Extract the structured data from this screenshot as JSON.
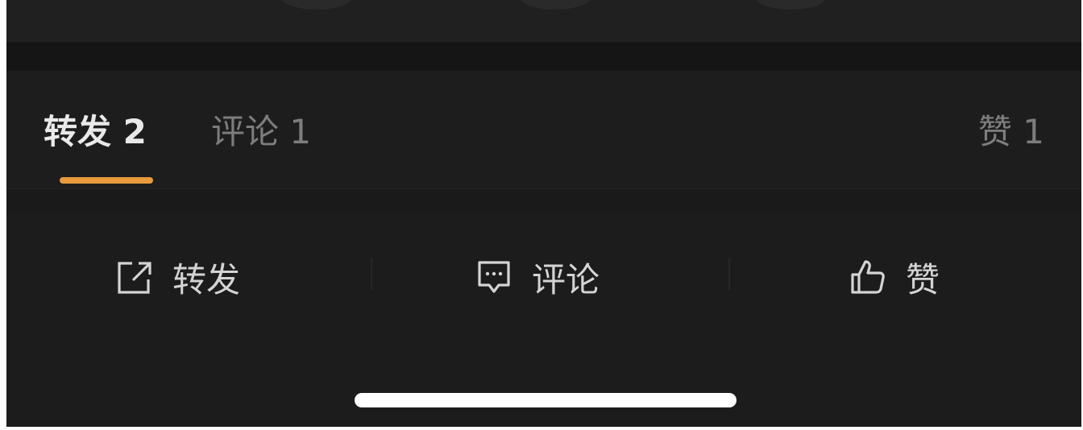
{
  "tabs": {
    "repost": {
      "label": "转发",
      "count": "2"
    },
    "comment": {
      "label": "评论",
      "count": "1"
    },
    "like": {
      "label": "赞",
      "count": "1"
    },
    "active": "repost"
  },
  "actions": {
    "repost_label": "转发",
    "comment_label": "评论",
    "like_label": "赞"
  },
  "icons": {
    "repost": "share-external-icon",
    "comment": "comment-bubble-icon",
    "like": "thumbs-up-icon"
  },
  "colors": {
    "accent": "#e89a3c",
    "background": "#1c1c1c",
    "active_text": "#e9e9e9",
    "inactive_text": "#7d7d7d"
  }
}
